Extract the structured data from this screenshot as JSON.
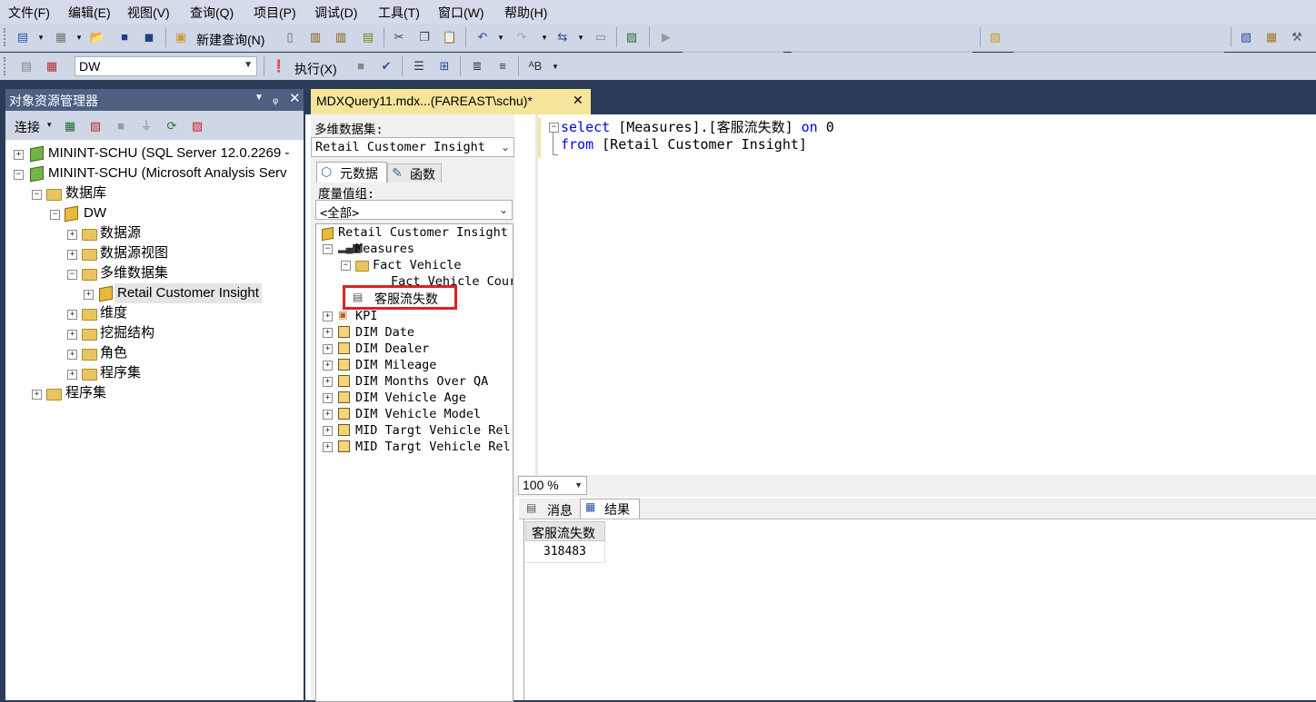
{
  "menu": [
    "文件(F)",
    "编辑(E)",
    "视图(V)",
    "查询(Q)",
    "项目(P)",
    "调试(D)",
    "工具(T)",
    "窗口(W)",
    "帮助(H)"
  ],
  "toolbar": {
    "new_query_label": "新建查询(N)",
    "database_value": "DW",
    "execute_label": "执行(X)"
  },
  "object_explorer": {
    "title": "对象资源管理器",
    "connect_label": "连接",
    "tree": {
      "server1": "MININT-SCHU (SQL Server 12.0.2269 -",
      "server2": "MININT-SCHU (Microsoft Analysis Serv",
      "databases": "数据库",
      "dw": "DW",
      "datasources": "数据源",
      "dsv": "数据源视图",
      "cubes": "多维数据集",
      "cube_rci": "Retail Customer Insight",
      "dimensions": "维度",
      "mining": "挖掘结构",
      "roles": "角色",
      "assemblies_db": "程序集",
      "assemblies": "程序集"
    }
  },
  "document_tab": {
    "title": "MDXQuery11.mdx...(FAREAST\\schu)*"
  },
  "metadata_panel": {
    "cube_label": "多维数据集:",
    "cube_value": "Retail Customer Insight",
    "tab_metadata": "元数据",
    "tab_functions": "函数",
    "measure_group_label": "度量值组:",
    "measure_group_value": "<全部>",
    "tree": {
      "root": "Retail Customer Insight",
      "measures": "Measures",
      "fact_vehicle": "Fact Vehicle",
      "fact_vehicle_count": "Fact Vehicle Cour",
      "calc_measure": "客服流失数",
      "kpi": "KPI",
      "dims": [
        "DIM Date",
        "DIM Dealer",
        "DIM Mileage",
        "DIM Months Over QA",
        "DIM Vehicle Age",
        "DIM Vehicle Model",
        "MID Targt Vehicle Rel",
        "MID Targt Vehicle Rel"
      ]
    }
  },
  "editor": {
    "line1": {
      "kw1": "select",
      "t1": " [Measures].[客服流失数] ",
      "kw2": "on",
      "t2": " 0"
    },
    "line2": {
      "kw1": "from",
      "t1": " [Retail Customer Insight]"
    }
  },
  "zoom": "100 %",
  "results": {
    "tab_messages": "消息",
    "tab_results": "结果",
    "column_header": "客服流失数",
    "value": "318483"
  },
  "colors": {
    "highlight_box": "#e02020",
    "keyword": "#0000ff",
    "tab_active": "#f5e59b"
  }
}
